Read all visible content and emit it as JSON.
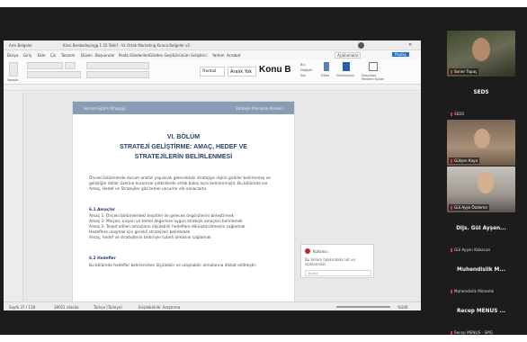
{
  "screen": {
    "tabs": [
      "Arm Belgeler",
      "Kinsi Benbelleyingg 1 22 Teklif - Vs Ortak Marketing Kiraca Belgeler v2"
    ],
    "menu": [
      "Dosya",
      "Giriş",
      "Ekle",
      "Çiz",
      "Tasarım",
      "Düzen",
      "Başvurular",
      "Posta Gönderileri",
      "Gözden Geçir",
      "Görünüm",
      "Geliştirici",
      "Yardım",
      "Acrobat"
    ],
    "ribbon": {
      "paste_label": "Yapıştır",
      "styles": [
        "Normal",
        "Aralık Yok",
        "Konu B"
      ],
      "find_label": "Bul",
      "replace_label": "Değiştir",
      "select_label": "Seç",
      "dictate_label": "Dikte",
      "editor_label": "Düzenleyici",
      "reuse_label": "Dosyaları Yeniden Kullan",
      "comments_btn": "Açıklamalar",
      "share_btn": "Paylaş"
    },
    "page": {
      "header_left": "Hizmet Eğitim Kitapçığı",
      "header_right": "Stratejik Planlama Rehberi",
      "chapter": "VI. BÖLÜM",
      "title_line1": "STRATEJİ GELİŞTİRME: AMAÇ, HEDEF VE",
      "title_line2": "STRATEJİLERİN BELİRLENMESİ",
      "intro": "Önceki bölümlerde durum analizi yapılarak gelecekteki stratejiye ilişkin girdiler belirlenmiş ve geliştiğin dallar üzerine kurumsal yetkililerde ortak bakış açısı belirlenmiştir. Bu bölümde ise Amaç, Hedef ve Stratejiler gibi temel unsurlar ele alınacaktır.",
      "heading1": "6.1 Amaçlar",
      "items": [
        "Amaç 1: Önceki bölümlerdeki tespitler ile gelecek öngörülerini birleştirmek",
        "Amaç 2: Misyon, vizyon ve temel değerlere uygun stratejik amaçları belirlemek",
        "Amaç 3: Tespit edilen amaçların ölçülebilir hedeflere dönüştürülmesini sağlamak",
        "Hedeflere ulaşmak için gerekli stratejileri belirlemek",
        "Amaç, hedef ve stratejilerin birbiriyle tutarlı olmasını sağlamak"
      ],
      "heading2": "6.2 Hedefler",
      "last_line": "Bu bölümde hedefler belirlenirken ölçülebilir ve ulaşılabilir olmalarına dikkat edilmiştir."
    },
    "comment": {
      "author": "Kullanıcı",
      "text": "Bu bölüm hakkındaki not ve açıklamalar",
      "reply_placeholder": "Yanıtla"
    },
    "status": {
      "page": "Sayfa 37 / 118",
      "words": "39021 sözcük",
      "language": "Türkçe (Türkiye)",
      "accessibility": "Erişilebilirlik: Araştırma",
      "zoom": "%100"
    }
  },
  "participants": {
    "tile1_caption": "Soner Topaç",
    "name1": "SEDS",
    "name1_small": "SEDS",
    "tile2_caption": "Gülşen Kaya",
    "tile3_caption": "Gül Ayşe Özdemir",
    "name2": "Dijs. Gül Ayşen...",
    "name2_small": "Gül Ayşen Kabacan",
    "name3": "Muhendislik M...",
    "name3_small": "Muhendislik Mimarlık",
    "name4": "Recep MENUS ...",
    "name4_small": "Recep MENUS - SMG",
    "more_icon": "chevron-down-icon"
  }
}
